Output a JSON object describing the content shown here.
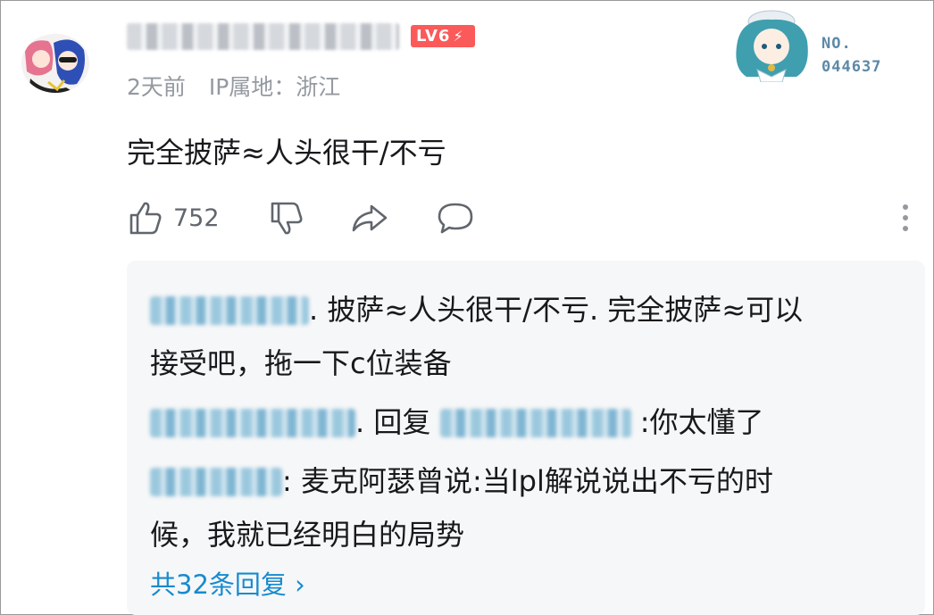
{
  "header": {
    "level_label": "LV6",
    "time": "2天前",
    "ip_location": "IP属地：浙江",
    "fan_badge_no": [
      "NO.",
      "044637"
    ]
  },
  "comment": {
    "text": "完全披萨≈人头很干/不亏",
    "like_count": "752"
  },
  "replies": {
    "items": [
      {
        "text_line1": ". 披萨≈人头很干/不亏.    完全披萨≈可以",
        "text_line2": "接受吧，拖一下c位装备"
      },
      {
        "prefix": ". 回复 ",
        "suffix": " :你太懂了"
      },
      {
        "text_line1": ": 麦克阿瑟曾说:当lpl解说说出不亏的时",
        "text_line2": "候，我就已经明白的局势"
      }
    ],
    "expand_label": "共32条回复 ›"
  },
  "icons": {
    "like": "thumbs-up-icon",
    "dislike": "thumbs-down-icon",
    "share": "share-icon",
    "reply": "comment-bubble-icon",
    "more": "more-vertical-icon"
  },
  "colors": {
    "level_badge": "#fb5a5a",
    "link": "#178bcf",
    "meta_text": "#9499a0",
    "reply_bg": "#f6f7f8"
  }
}
